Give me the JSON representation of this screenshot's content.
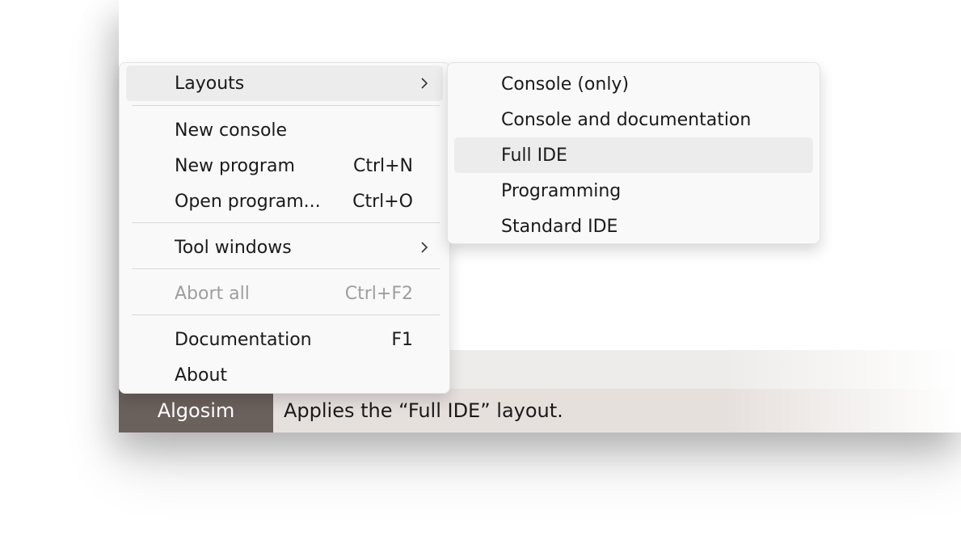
{
  "menu": {
    "items": [
      {
        "label": "Layouts",
        "shortcut": ""
      },
      {
        "label": "New console",
        "shortcut": ""
      },
      {
        "label": "New program",
        "shortcut": "Ctrl+N"
      },
      {
        "label": "Open program...",
        "shortcut": "Ctrl+O"
      },
      {
        "label": "Tool windows",
        "shortcut": ""
      },
      {
        "label": "Abort all",
        "shortcut": "Ctrl+F2"
      },
      {
        "label": "Documentation",
        "shortcut": "F1"
      },
      {
        "label": "About",
        "shortcut": ""
      }
    ]
  },
  "submenu": {
    "items": [
      {
        "label": "Console (only)"
      },
      {
        "label": "Console and documentation"
      },
      {
        "label": "Full IDE"
      },
      {
        "label": "Programming"
      },
      {
        "label": "Standard IDE"
      }
    ]
  },
  "statusbar": {
    "app_button": "Algosim",
    "message": "Applies the “Full IDE” layout."
  },
  "icons": {
    "submenu_arrow": "chevron-right-icon"
  },
  "colors": {
    "app_button_bg": "#6a605c",
    "highlight": "#ececec",
    "disabled_text": "#9e9e9e"
  }
}
